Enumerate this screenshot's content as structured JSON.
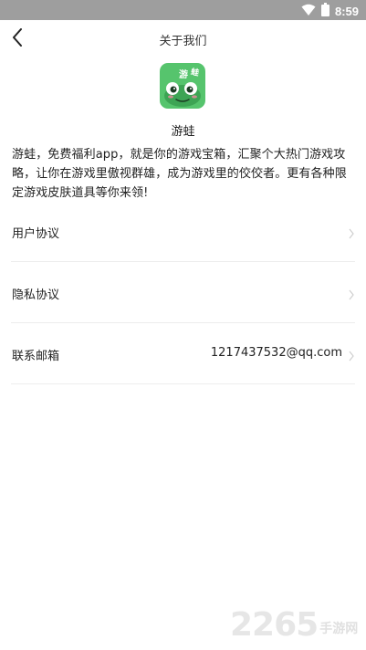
{
  "status_bar": {
    "time": "8:59",
    "wifi_icon": "wifi-icon",
    "battery_icon": "battery-icon"
  },
  "nav": {
    "title": "关于我们",
    "back_icon": "back-arrow-icon"
  },
  "app": {
    "icon_text": "游蛙",
    "name": "游蛙",
    "description": "游蛙，免费福利app，就是你的游戏宝箱，汇聚个大热门游戏攻略，让你在游戏里傲视群雄，成为游戏里的佼佼者。更有各种限定游戏皮肤道具等你来领!",
    "icon_color": "#56c46d"
  },
  "menu": [
    {
      "label": "用户协议",
      "value": ""
    },
    {
      "label": "隐私协议",
      "value": ""
    },
    {
      "label": "联系邮箱",
      "value": "1217437532@qq.com"
    }
  ],
  "watermark": {
    "number": "2265",
    "text": "手游网"
  }
}
